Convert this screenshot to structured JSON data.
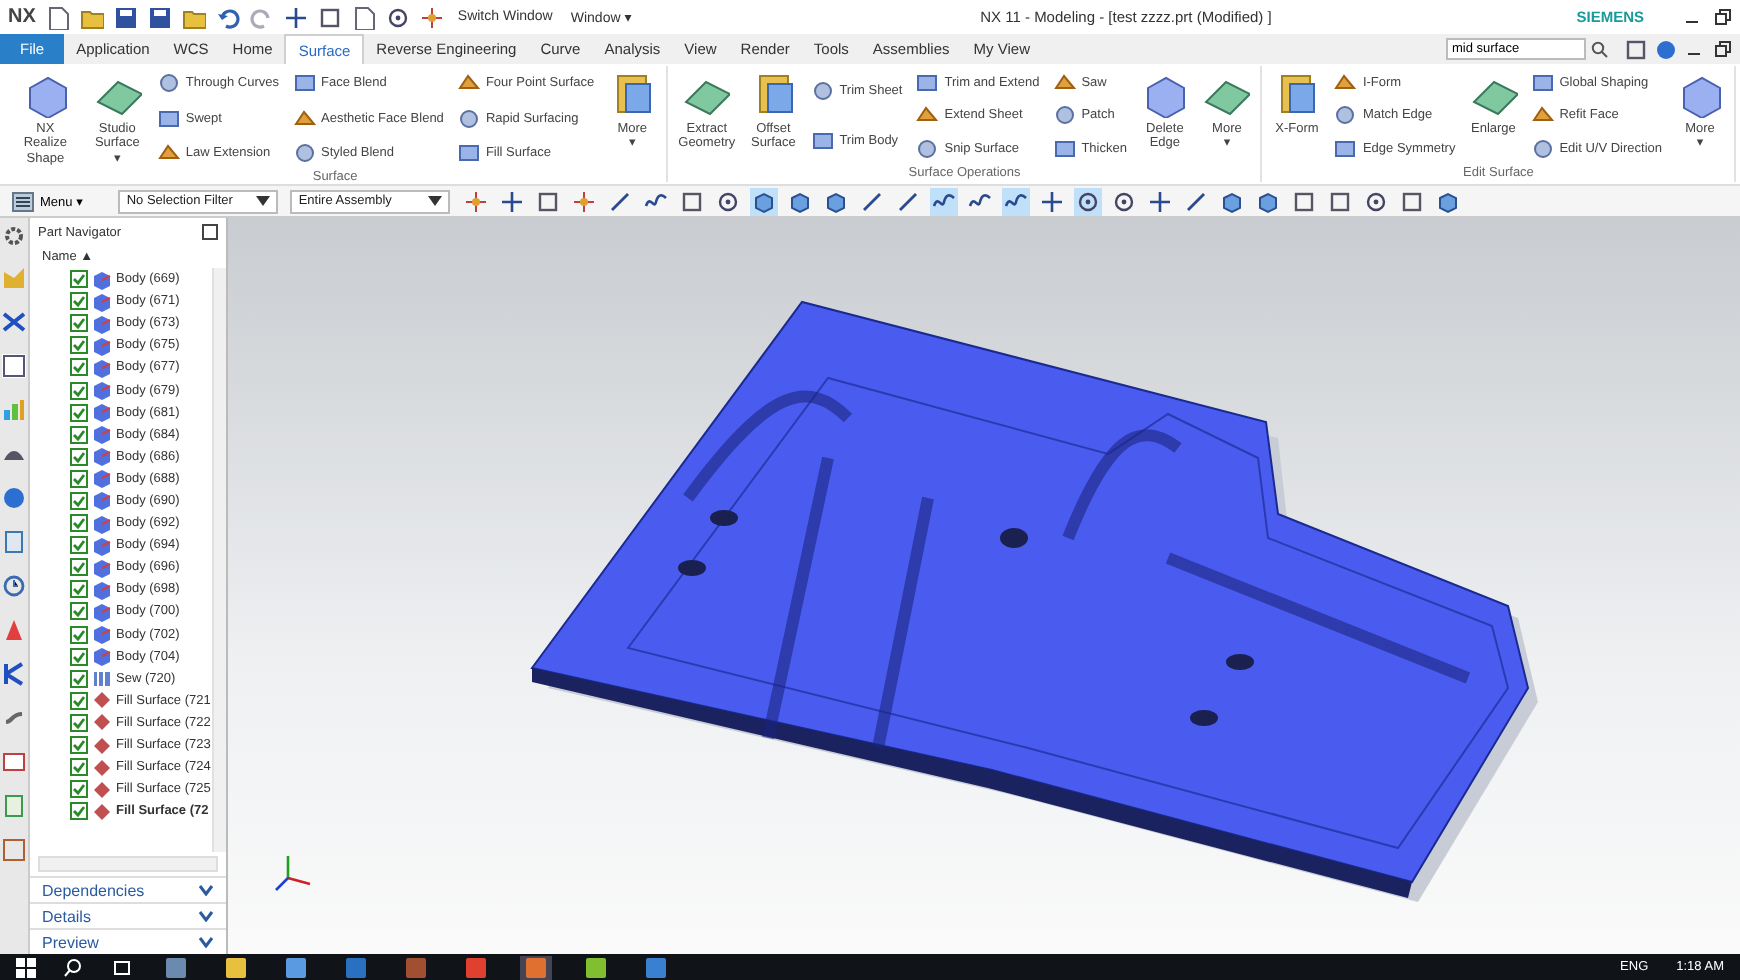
{
  "title_bar": {
    "app": "NX",
    "quick_buttons": [
      "Switch Window",
      "Window ▾"
    ],
    "title": "NX 11 - Modeling - [test zzzz.prt (Modified) ]",
    "brand": "SIEMENS"
  },
  "tabs": [
    {
      "label": "File",
      "kind": "file",
      "selected": false
    },
    {
      "label": "Application",
      "kind": "tab",
      "selected": false
    },
    {
      "label": "WCS",
      "kind": "tab",
      "selected": false
    },
    {
      "label": "Home",
      "kind": "tab",
      "selected": false
    },
    {
      "label": "Surface",
      "kind": "tab",
      "selected": true
    },
    {
      "label": "Reverse Engineering",
      "kind": "tab",
      "selected": false
    },
    {
      "label": "Curve",
      "kind": "tab",
      "selected": false
    },
    {
      "label": "Analysis",
      "kind": "tab",
      "selected": false
    },
    {
      "label": "View",
      "kind": "tab",
      "selected": false
    },
    {
      "label": "Render",
      "kind": "tab",
      "selected": false
    },
    {
      "label": "Tools",
      "kind": "tab",
      "selected": false
    },
    {
      "label": "Assemblies",
      "kind": "tab",
      "selected": false
    },
    {
      "label": "My View",
      "kind": "tab",
      "selected": false
    }
  ],
  "search": {
    "value": "mid surface"
  },
  "ribbon": [
    {
      "label": "Surface",
      "columns": [
        {
          "kind": "large",
          "items": [
            "NX Realize\nShape"
          ]
        },
        {
          "kind": "large",
          "items": [
            "Studio\nSurface ▾"
          ]
        },
        {
          "kind": "stack",
          "items": [
            "Through Curves",
            "Swept",
            "Law Extension"
          ]
        },
        {
          "kind": "stack",
          "items": [
            "Face Blend",
            "Aesthetic Face Blend",
            "Styled Blend"
          ]
        },
        {
          "kind": "stack",
          "items": [
            "Four Point Surface",
            "Rapid Surfacing",
            "Fill Surface"
          ]
        },
        {
          "kind": "large",
          "items": [
            "More\n▾"
          ]
        }
      ]
    },
    {
      "label": "Surface Operations",
      "columns": [
        {
          "kind": "large",
          "items": [
            "Extract\nGeometry"
          ]
        },
        {
          "kind": "large",
          "items": [
            "Offset\nSurface"
          ]
        },
        {
          "kind": "stack",
          "items": [
            "Trim Sheet",
            "Trim Body"
          ]
        },
        {
          "kind": "stack",
          "items": [
            "Trim and Extend",
            "Extend Sheet",
            "Snip Surface"
          ]
        },
        {
          "kind": "stack",
          "items": [
            "Saw",
            "Patch",
            "Thicken"
          ]
        },
        {
          "kind": "large",
          "items": [
            "Delete\nEdge"
          ]
        },
        {
          "kind": "large",
          "items": [
            "More\n▾"
          ]
        }
      ]
    },
    {
      "label": "Edit Surface",
      "columns": [
        {
          "kind": "large",
          "items": [
            "X-Form"
          ]
        },
        {
          "kind": "stack",
          "items": [
            "I-Form",
            "Match Edge",
            "Edge Symmetry"
          ]
        },
        {
          "kind": "large",
          "items": [
            "Enlarge"
          ]
        },
        {
          "kind": "stack",
          "items": [
            "Global Shaping",
            "Refit Face",
            "Edit U/V Direction"
          ]
        },
        {
          "kind": "large",
          "items": [
            "More\n▾"
          ]
        }
      ]
    }
  ],
  "toolbar": {
    "menu": "Menu ▾",
    "filters": [
      "No Selection Filter",
      "Entire Assembly"
    ],
    "buttons": [
      {
        "on": false
      },
      {
        "on": false
      },
      {
        "on": false
      },
      {
        "on": false
      },
      {
        "on": false
      },
      {
        "on": false
      },
      {
        "on": false
      },
      {
        "on": false
      },
      {
        "on": true
      },
      {
        "on": false
      },
      {
        "on": false
      },
      {
        "on": false
      },
      {
        "on": false
      },
      {
        "on": true
      },
      {
        "on": false
      },
      {
        "on": true
      },
      {
        "on": false
      },
      {
        "on": true
      },
      {
        "on": false
      },
      {
        "on": false
      },
      {
        "on": false
      },
      {
        "on": false
      },
      {
        "on": false
      },
      {
        "on": false
      },
      {
        "on": false
      },
      {
        "on": false
      },
      {
        "on": false
      },
      {
        "on": false
      }
    ]
  },
  "navigator": {
    "title": "Part Navigator",
    "column": "Name ▲",
    "rows": [
      {
        "label": "Body (669)",
        "kind": "body",
        "checked": true,
        "current": false
      },
      {
        "label": "Body (671)",
        "kind": "body",
        "checked": true,
        "current": false
      },
      {
        "label": "Body (673)",
        "kind": "body",
        "checked": true,
        "current": false
      },
      {
        "label": "Body (675)",
        "kind": "body",
        "checked": true,
        "current": false
      },
      {
        "label": "Body (677)",
        "kind": "body",
        "checked": true,
        "current": false
      },
      {
        "label": "Body (679)",
        "kind": "body",
        "checked": true,
        "current": false
      },
      {
        "label": "Body (681)",
        "kind": "body",
        "checked": true,
        "current": false
      },
      {
        "label": "Body (684)",
        "kind": "body",
        "checked": true,
        "current": false
      },
      {
        "label": "Body (686)",
        "kind": "body",
        "checked": true,
        "current": false
      },
      {
        "label": "Body (688)",
        "kind": "body",
        "checked": true,
        "current": false
      },
      {
        "label": "Body (690)",
        "kind": "body",
        "checked": true,
        "current": false
      },
      {
        "label": "Body (692)",
        "kind": "body",
        "checked": true,
        "current": false
      },
      {
        "label": "Body (694)",
        "kind": "body",
        "checked": true,
        "current": false
      },
      {
        "label": "Body (696)",
        "kind": "body",
        "checked": true,
        "current": false
      },
      {
        "label": "Body (698)",
        "kind": "body",
        "checked": true,
        "current": false
      },
      {
        "label": "Body (700)",
        "kind": "body",
        "checked": true,
        "current": false
      },
      {
        "label": "Body (702)",
        "kind": "body",
        "checked": true,
        "current": false
      },
      {
        "label": "Body (704)",
        "kind": "body",
        "checked": true,
        "current": false
      },
      {
        "label": "Sew (720)",
        "kind": "sew",
        "checked": true,
        "current": false
      },
      {
        "label": "Fill Surface (721",
        "kind": "fill",
        "checked": true,
        "current": false
      },
      {
        "label": "Fill Surface (722",
        "kind": "fill",
        "checked": true,
        "current": false
      },
      {
        "label": "Fill Surface (723",
        "kind": "fill",
        "checked": true,
        "current": false
      },
      {
        "label": "Fill Surface (724",
        "kind": "fill",
        "checked": true,
        "current": false
      },
      {
        "label": "Fill Surface (725",
        "kind": "fill",
        "checked": true,
        "current": false
      },
      {
        "label": "Fill Surface (72",
        "kind": "fill",
        "checked": true,
        "current": true
      }
    ],
    "panels": [
      {
        "label": "Dependencies",
        "expanded": false
      },
      {
        "label": "Details",
        "expanded": false
      },
      {
        "label": "Preview",
        "expanded": false
      }
    ]
  },
  "taskbar": {
    "apps": [
      {
        "active": false
      },
      {
        "active": false
      },
      {
        "active": false
      },
      {
        "active": false
      },
      {
        "active": false
      },
      {
        "active": false
      },
      {
        "active": true
      },
      {
        "active": false
      },
      {
        "active": false
      }
    ],
    "time": "1:18 AM",
    "language": "ENG"
  }
}
